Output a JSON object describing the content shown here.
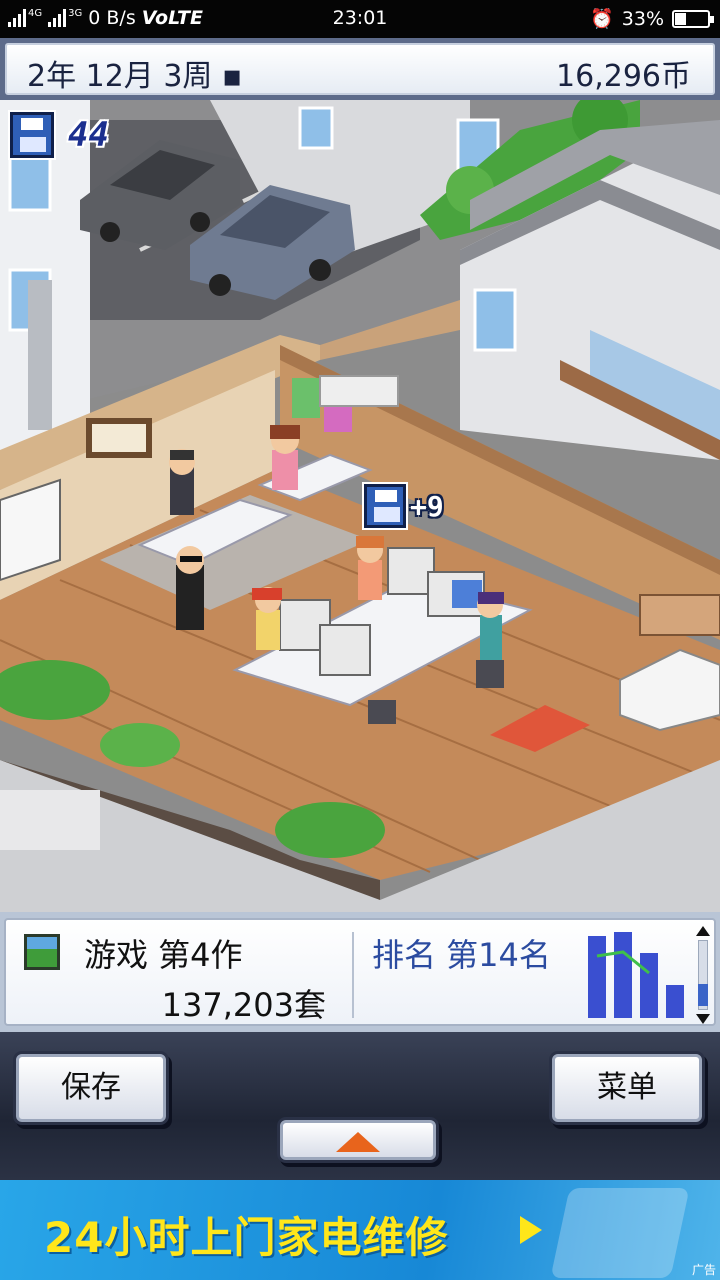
{
  "status_bar": {
    "net1": "4G",
    "net2": "3G",
    "speed": "0 B/s",
    "volte": "VoLTE",
    "time": "23:01",
    "alarm_icon": "alarm-clock-icon",
    "battery_pct": "33%",
    "battery_level": 0.33
  },
  "top_bar": {
    "date": "2年 12月 3周 ▪",
    "money": "16,296币"
  },
  "hud": {
    "disk_icon": "floppy-disk-icon",
    "disk_count": "44",
    "bonus": "+9"
  },
  "info": {
    "game_title": "游戏 第4作",
    "sales": "137,203套",
    "rank": "排名 第14名",
    "rank_chart": {
      "bars": [
        0.95,
        1.0,
        0.75,
        0.38
      ],
      "color": "#3a4fd0"
    }
  },
  "controls": {
    "save_label": "保存",
    "menu_label": "菜单",
    "expand_icon": "up-arrow-icon"
  },
  "ad": {
    "text": "24小时上门家电维修",
    "play_icon": "play-icon",
    "mark": "广告"
  }
}
